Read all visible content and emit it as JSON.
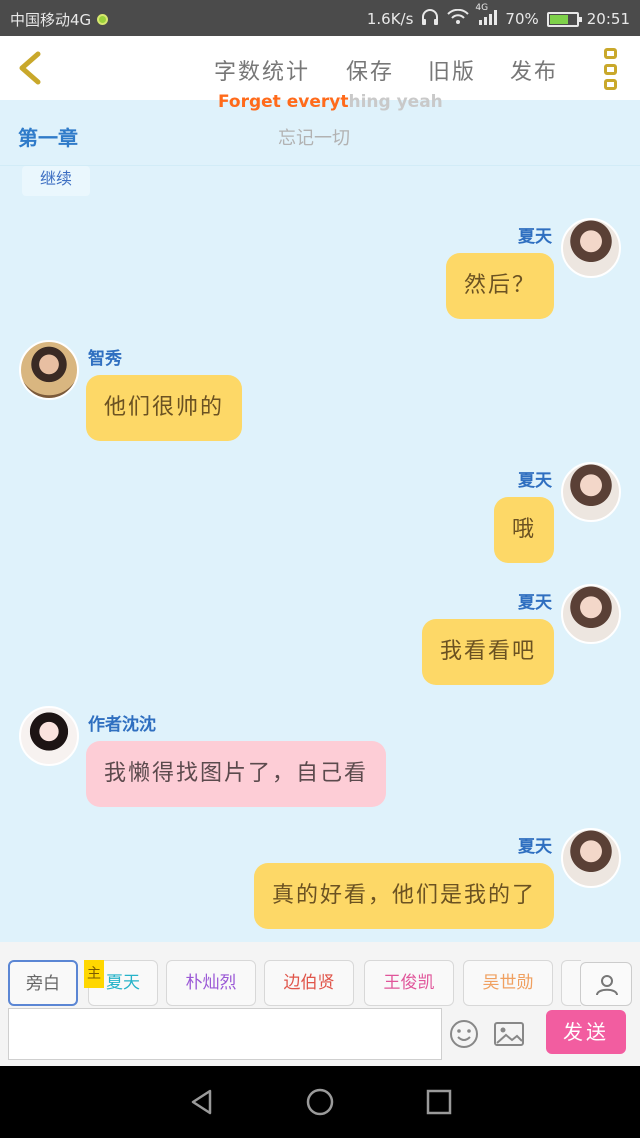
{
  "status_bar": {
    "carrier": "中国移动4G",
    "speed": "1.6K/s",
    "network_label": "4G",
    "battery": "70%",
    "battery_level": 0.7,
    "time": "20:51"
  },
  "toolbar": {
    "word_count": "字数统计",
    "save": "保存",
    "old_version": "旧版",
    "publish": "发布"
  },
  "song": {
    "english_highlight": "Forget everyt",
    "english_rest": "hing yeah",
    "chinese": "忘记一切"
  },
  "chapter": "第一章",
  "continue_label": "继续",
  "messages": [
    {
      "sender": "夏天",
      "text": "然后？",
      "side": "right",
      "color": "yellow"
    },
    {
      "sender": "智秀",
      "text": "他们很帅的",
      "side": "left",
      "color": "yellow"
    },
    {
      "sender": "夏天",
      "text": "哦",
      "side": "right",
      "color": "yellow"
    },
    {
      "sender": "夏天",
      "text": "我看看吧",
      "side": "right",
      "color": "yellow"
    },
    {
      "sender": "作者沈沈",
      "text": "我懒得找图片了，自己看",
      "side": "left",
      "color": "pink"
    },
    {
      "sender": "夏天",
      "text": "真的好看，他们是我的了",
      "side": "right",
      "color": "yellow"
    }
  ],
  "roles": [
    {
      "label": "旁白",
      "color": "#666666"
    },
    {
      "label": "夏天",
      "color": "#26b3c9"
    },
    {
      "label": "朴灿烈",
      "color": "#9b59d6"
    },
    {
      "label": "边伯贤",
      "color": "#e0554a"
    },
    {
      "label": "王俊凯",
      "color": "#e0559a"
    },
    {
      "label": "吴世勋",
      "color": "#f0a060"
    }
  ],
  "main_badge": "主",
  "input": {
    "value": "",
    "placeholder": ""
  },
  "send_label": "发送"
}
